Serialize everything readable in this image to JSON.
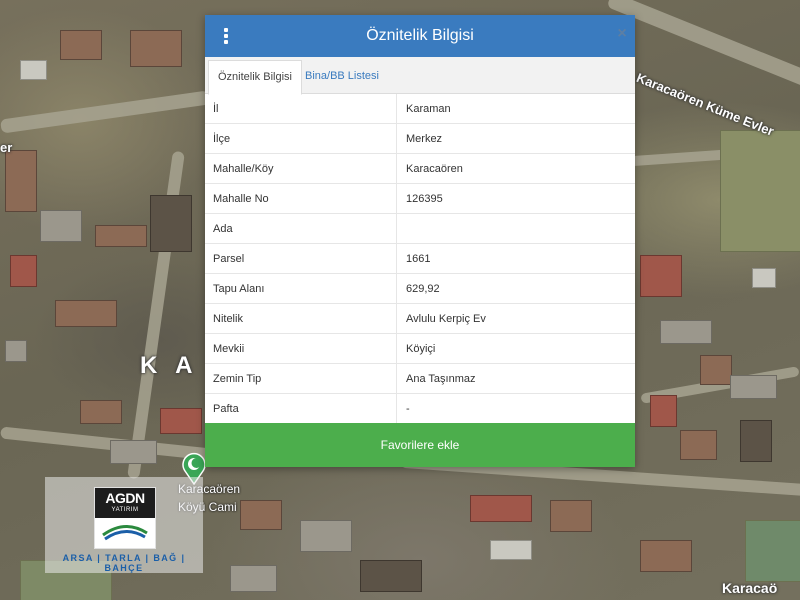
{
  "map": {
    "labels": {
      "village_road": "Karacaören Küme Evler",
      "top_left_fragment": "er",
      "center_fragment": "K A",
      "mosque_line1": "Karacaören",
      "mosque_line2": "Köyü Cami",
      "bottom_right": "Karacaö"
    },
    "icons": {
      "marker": "mosque-marker-icon"
    }
  },
  "logo": {
    "name": "AGDN",
    "sub": "YATIRIM",
    "tagline": "ARSA | TARLA | BAĞ | BAHÇE"
  },
  "dialog": {
    "title": "Öznitelik Bilgisi",
    "menu_icon": "vertical-dots-icon",
    "close_symbol": "×",
    "tabs": [
      {
        "label": "Öznitelik Bilgisi",
        "active": true
      },
      {
        "label": "Bina/BB Listesi",
        "active": false
      }
    ],
    "rows": [
      {
        "key": "İl",
        "value": "Karaman"
      },
      {
        "key": "İlçe",
        "value": "Merkez"
      },
      {
        "key": "Mahalle/Köy",
        "value": "Karacaören"
      },
      {
        "key": "Mahalle No",
        "value": "126395"
      },
      {
        "key": "Ada",
        "value": ""
      },
      {
        "key": "Parsel",
        "value": "1661"
      },
      {
        "key": "Tapu Alanı",
        "value": "629,92"
      },
      {
        "key": "Nitelik",
        "value": "Avlulu Kerpiç Ev"
      },
      {
        "key": "Mevkii",
        "value": "Köyiçi"
      },
      {
        "key": "Zemin Tip",
        "value": "Ana Taşınmaz"
      },
      {
        "key": "Pafta",
        "value": "-"
      }
    ],
    "favorite_button": "Favorilere ekle"
  },
  "colors": {
    "header": "#3a7bbf",
    "favorite": "#4cae4c",
    "tab_link": "#3a7bbf"
  }
}
